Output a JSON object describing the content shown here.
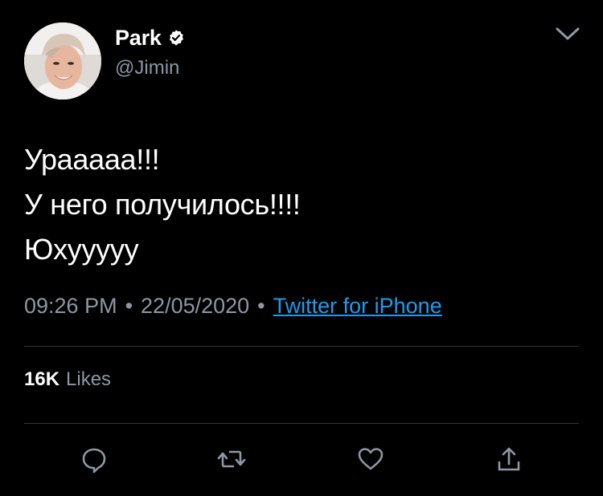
{
  "author": {
    "display_name": "Park",
    "handle": "@Jimin",
    "verified": true,
    "avatar_icon": "avatar-photo"
  },
  "tweet": {
    "lines": [
      "Урааааа!!!",
      "У него получилось!!!!",
      "Юхууууу"
    ]
  },
  "meta": {
    "time": "09:26 PM",
    "separator": "•",
    "date": "22/05/2020",
    "source": "Twitter for iPhone"
  },
  "stats": {
    "likes_count": "16K",
    "likes_label": "Likes"
  },
  "actions": {
    "reply_icon": "reply-icon",
    "retweet_icon": "retweet-icon",
    "like_icon": "heart-icon",
    "share_icon": "share-icon"
  },
  "colors": {
    "background": "#000000",
    "text_primary": "#ffffff",
    "text_secondary": "#8b98a5",
    "link": "#1d9bf0",
    "divider": "#2f3336",
    "verified_badge": "#ffffff"
  }
}
